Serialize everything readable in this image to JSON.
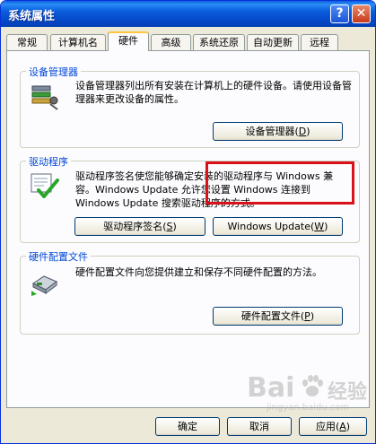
{
  "window": {
    "title": "系统属性"
  },
  "tabs": [
    {
      "label": "常规"
    },
    {
      "label": "计算机名"
    },
    {
      "label": "硬件"
    },
    {
      "label": "高级"
    },
    {
      "label": "系统还原"
    },
    {
      "label": "自动更新"
    },
    {
      "label": "远程"
    }
  ],
  "device_manager": {
    "title": "设备管理器",
    "description": "设备管理器列出所有安装在计算机上的硬件设备。请使用设备管理器来更改设备的属性。",
    "button_label": "设备管理器",
    "button_key": "D"
  },
  "drivers": {
    "title": "驱动程序",
    "description": "驱动程序签名使您能够确定安装的驱动程序与 Windows 兼容。Windows Update 允许您设置 Windows 连接到 Windows Update 搜索驱动程序的方式。",
    "signing_label": "驱动程序签名",
    "signing_key": "S",
    "update_label": "Windows Update",
    "update_key": "W"
  },
  "hardware_profiles": {
    "title": "硬件配置文件",
    "description": "硬件配置文件向您提供建立和保存不同硬件配置的方法。",
    "button_label": "硬件配置文件",
    "button_key": "P"
  },
  "footer": {
    "ok_label": "确定",
    "cancel_label": "取消",
    "apply_label": "应用",
    "apply_key": "A"
  },
  "watermark": {
    "brand": "Bai",
    "brand_cn": "经验",
    "url": "jingyan.baidu.com"
  },
  "colors": {
    "title_bar": "#0a5ddc",
    "highlight_box": "#d8111a",
    "group_title": "#0046d5"
  }
}
